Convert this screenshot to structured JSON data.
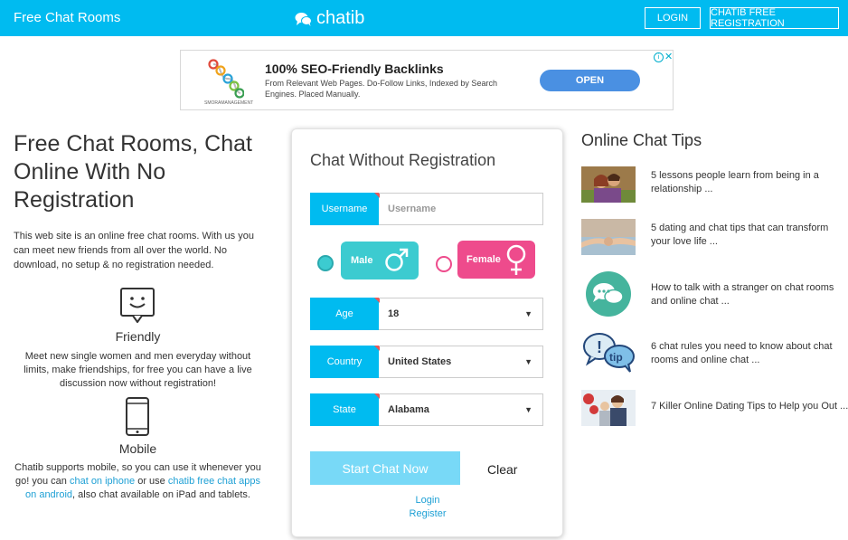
{
  "header": {
    "site_title": "Free Chat Rooms",
    "logo_text": "chatib",
    "login_label": "LOGIN",
    "register_label": "CHATIB FREE REGISTRATION",
    "bg_color": "#00bbf0"
  },
  "ad": {
    "logo_caption": "SMORAMANAGEMENT",
    "title": "100% SEO-Friendly Backlinks",
    "description": "From Relevant Web Pages. Do-Follow Links, Indexed by Search Engines. Placed Manually.",
    "open_label": "OPEN",
    "info_icon": "i",
    "close_icon": "✕"
  },
  "intro": {
    "title": "Free Chat Rooms, Chat Online With No Registration",
    "text": "This web site is an online free chat rooms. With us you can meet new friends from all over the world. No download, no setup & no registration needed.",
    "features": [
      {
        "icon": "smiley-chat-icon",
        "title": "Friendly",
        "text": "Meet new single women and men everyday without limits, make friendships, for free you can have a live discussion now without registration!"
      },
      {
        "icon": "mobile-phone-icon",
        "title": "Mobile",
        "text_before": "Chatib supports mobile, so you can use it whenever you go! you can ",
        "link1": "chat on iphone",
        "text_middle": " or use ",
        "link2": "chatib free chat apps on android",
        "text_after": ", also chat available on iPad and tablets."
      }
    ]
  },
  "form": {
    "title": "Chat Without Registration",
    "username": {
      "label": "Username",
      "placeholder": "Username"
    },
    "gender": {
      "male_label": "Male",
      "female_label": "Female",
      "male_color": "#3ccbd0",
      "female_color": "#ee4b8c",
      "selected": "Male"
    },
    "age": {
      "label": "Age",
      "value": "18"
    },
    "country": {
      "label": "Country",
      "value": "United States"
    },
    "state": {
      "label": "State",
      "value": "Alabama"
    },
    "start_label": "Start Chat Now",
    "clear_label": "Clear",
    "login_link": "Login",
    "register_link": "Register"
  },
  "tips": {
    "title": "Online Chat Tips",
    "items": [
      {
        "text": "5 lessons people learn from being in a relationship ...",
        "thumb": "couple-photo"
      },
      {
        "text": "5 dating and chat tips that can transform your love life ...",
        "thumb": "holding-hands-photo"
      },
      {
        "text": "How to talk with a stranger on chat rooms and online chat ...",
        "thumb": "chat-bubbles-icon"
      },
      {
        "text": "6 chat rules you need to know about chat rooms and online chat ...",
        "thumb": "tip-bubbles-icon"
      },
      {
        "text": "7 Killer Online Dating Tips to Help you Out ...",
        "thumb": "winter-couple-photo"
      }
    ]
  }
}
